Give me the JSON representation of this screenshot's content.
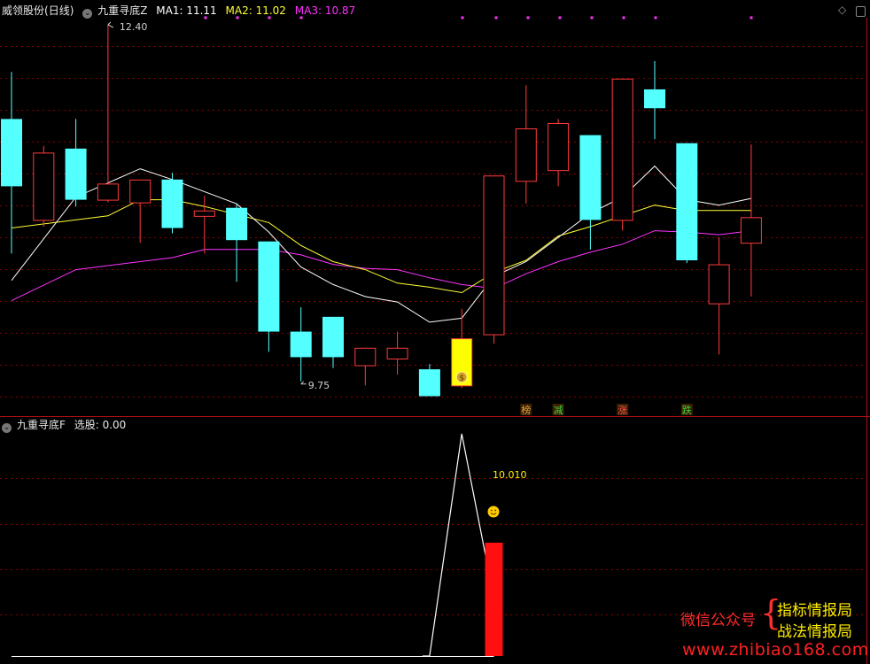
{
  "main_panel": {
    "stock_name": "威领股份",
    "period": "(日线)",
    "indicator": "九重寻底Z",
    "ma1_label": "MA1: 11.11",
    "ma2_label": "MA2: 11.02",
    "ma3_label": "MA3: 10.87",
    "max_label": "12.40",
    "min_label": "9.75",
    "signals": [
      "榜",
      "减",
      "涨",
      "跌"
    ]
  },
  "sub_panel": {
    "indicator": "九重寻底F",
    "value_label": "选股: 0.00",
    "annotation": "10.010"
  },
  "watermark": {
    "line_left": "微信公众号",
    "line_right_1": "指标情报局",
    "line_right_2": "战法情报局",
    "url": "www.zhibiao168.com"
  },
  "colors": {
    "up": "#ff3b3b",
    "down": "#54ffff",
    "ma1": "#ffffff",
    "ma2": "#ffff33",
    "ma3": "#ff33ff",
    "highlight": "#ffff00",
    "grid": "#8b0000"
  },
  "chart_data": {
    "type": "candlestick",
    "y_range": [
      9.6,
      12.5
    ],
    "candles": [
      {
        "o": 11.7,
        "h": 12.05,
        "l": 10.7,
        "c": 11.2,
        "dir": "down"
      },
      {
        "o": 10.95,
        "h": 11.5,
        "l": 10.9,
        "c": 11.45,
        "dir": "up"
      },
      {
        "o": 11.48,
        "h": 11.7,
        "l": 11.05,
        "c": 11.1,
        "dir": "down"
      },
      {
        "o": 11.1,
        "h": 12.4,
        "l": 11.08,
        "c": 11.22,
        "dir": "up"
      },
      {
        "o": 11.08,
        "h": 11.25,
        "l": 10.78,
        "c": 11.25,
        "dir": "up"
      },
      {
        "o": 11.25,
        "h": 11.3,
        "l": 10.85,
        "c": 10.89,
        "dir": "down"
      },
      {
        "o": 10.98,
        "h": 11.13,
        "l": 10.7,
        "c": 11.02,
        "dir": "up"
      },
      {
        "o": 11.04,
        "h": 11.07,
        "l": 10.49,
        "c": 10.8,
        "dir": "down"
      },
      {
        "o": 10.79,
        "h": 10.79,
        "l": 9.97,
        "c": 10.12,
        "dir": "down"
      },
      {
        "o": 10.12,
        "h": 10.3,
        "l": 9.75,
        "c": 9.93,
        "dir": "down"
      },
      {
        "o": 10.23,
        "h": 10.23,
        "l": 9.85,
        "c": 9.93,
        "dir": "down"
      },
      {
        "o": 9.87,
        "h": 10.0,
        "l": 9.72,
        "c": 10.0,
        "dir": "up"
      },
      {
        "o": 9.92,
        "h": 10.12,
        "l": 9.8,
        "c": 10.0,
        "dir": "up"
      },
      {
        "o": 9.84,
        "h": 9.88,
        "l": 9.65,
        "c": 9.64,
        "dir": "down"
      },
      {
        "o": 9.72,
        "h": 10.29,
        "l": 9.7,
        "c": 10.07,
        "dir": "highlight"
      },
      {
        "o": 10.1,
        "h": 11.28,
        "l": 10.03,
        "c": 11.28,
        "dir": "up"
      },
      {
        "o": 11.24,
        "h": 11.95,
        "l": 11.07,
        "c": 11.63,
        "dir": "up"
      },
      {
        "o": 11.32,
        "h": 11.7,
        "l": 11.2,
        "c": 11.67,
        "dir": "up"
      },
      {
        "o": 11.58,
        "h": 11.58,
        "l": 10.73,
        "c": 10.95,
        "dir": "down"
      },
      {
        "o": 10.95,
        "h": 12.0,
        "l": 10.87,
        "c": 12.0,
        "dir": "up"
      },
      {
        "o": 11.92,
        "h": 12.13,
        "l": 11.55,
        "c": 11.78,
        "dir": "down"
      },
      {
        "o": 11.52,
        "h": 11.52,
        "l": 10.63,
        "c": 10.65,
        "dir": "down"
      },
      {
        "o": 10.33,
        "h": 10.82,
        "l": 9.95,
        "c": 10.62,
        "dir": "up"
      },
      {
        "o": 10.78,
        "h": 11.51,
        "l": 10.38,
        "c": 10.97,
        "dir": "up"
      }
    ],
    "ma1": [
      10.5,
      null,
      11.12,
      null,
      11.33,
      11.25,
      null,
      11.07,
      10.86,
      10.6,
      10.47,
      10.38,
      10.34,
      10.19,
      10.22,
      10.53,
      10.64,
      10.82,
      11.0,
      11.12,
      11.35,
      11.1,
      11.06,
      11.11
    ],
    "ma2": [
      10.89,
      null,
      null,
      10.98,
      11.1,
      11.1,
      11.05,
      null,
      10.93,
      10.76,
      10.64,
      10.58,
      10.48,
      10.45,
      10.41,
      10.56,
      10.65,
      10.83,
      10.9,
      10.98,
      11.06,
      11.02,
      11.02,
      11.02
    ],
    "ma3": [
      10.35,
      null,
      10.58,
      null,
      null,
      10.67,
      10.73,
      null,
      10.73,
      10.69,
      10.62,
      10.59,
      10.58,
      10.52,
      10.47,
      10.44,
      10.55,
      10.64,
      10.71,
      10.77,
      10.87,
      10.86,
      10.84,
      10.87
    ],
    "signals_at": [
      16,
      17,
      19,
      21
    ],
    "sub": {
      "y_range": [
        0,
        10
      ],
      "line": [
        0,
        0,
        0,
        0,
        0,
        0,
        0,
        0,
        0,
        0,
        0,
        0,
        0,
        0,
        10,
        2.6
      ],
      "bar_index": 15,
      "bar_value": 5.1
    }
  }
}
